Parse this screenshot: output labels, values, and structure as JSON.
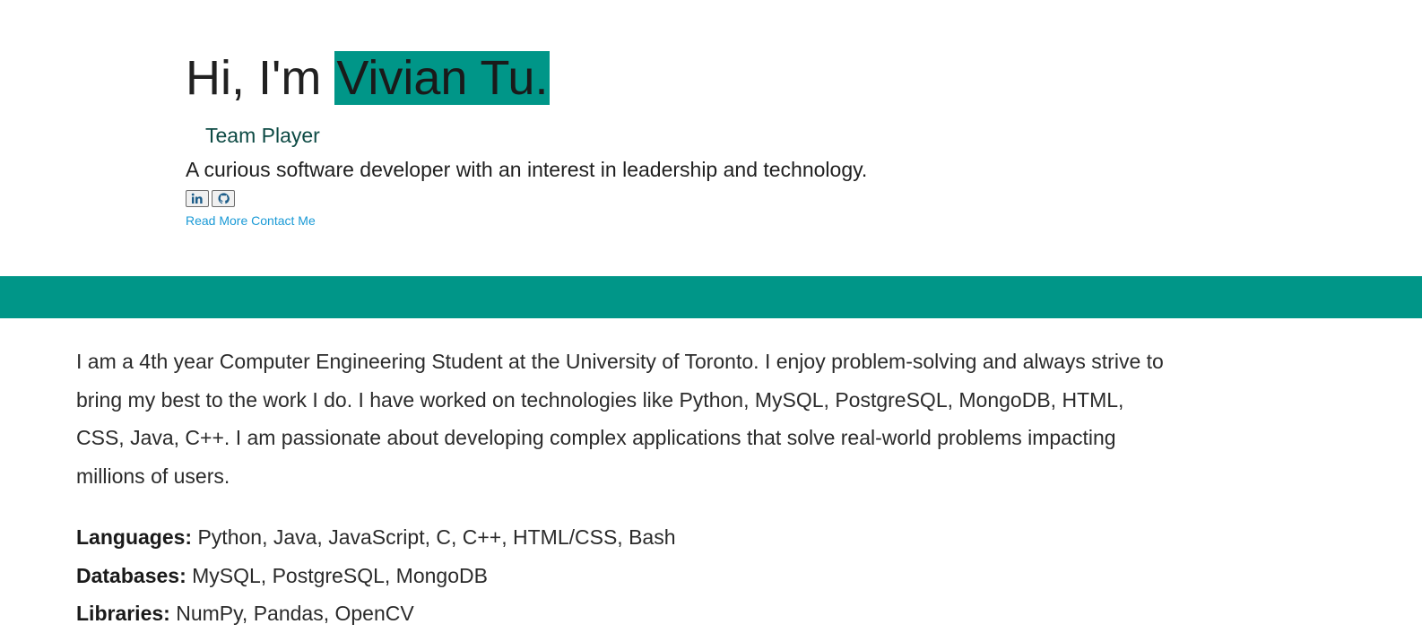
{
  "hero": {
    "greeting": "Hi, I'm ",
    "name": "Vivian Tu.",
    "typed_role": "Team Player",
    "tagline": "A curious software developer with an interest in leadership and technology.",
    "social": [
      {
        "icon": "linkedin-icon"
      },
      {
        "icon": "github-icon"
      }
    ],
    "links": {
      "read_more": "Read More",
      "contact_me": "Contact Me"
    }
  },
  "about": {
    "paragraph": "I am a 4th year Computer Engineering Student at the University of Toronto. I enjoy problem-solving and always strive to bring my best to the work I do. I have worked on technologies like Python, MySQL, PostgreSQL, MongoDB, HTML, CSS, Java, C++. I am passionate about developing complex applications that solve real-world problems impacting millions of users."
  },
  "skills": [
    {
      "label": "Languages:",
      "value": " Python, Java, JavaScript, C, C++, HTML/CSS, Bash"
    },
    {
      "label": "Databases:",
      "value": " MySQL, PostgreSQL, MongoDB"
    },
    {
      "label": "Libraries:",
      "value": " NumPy, Pandas, OpenCV"
    }
  ],
  "colors": {
    "accent": "#009688",
    "link": "#1a9ad6",
    "typed_role": "#0d4a44",
    "text": "#2b2b2b"
  }
}
